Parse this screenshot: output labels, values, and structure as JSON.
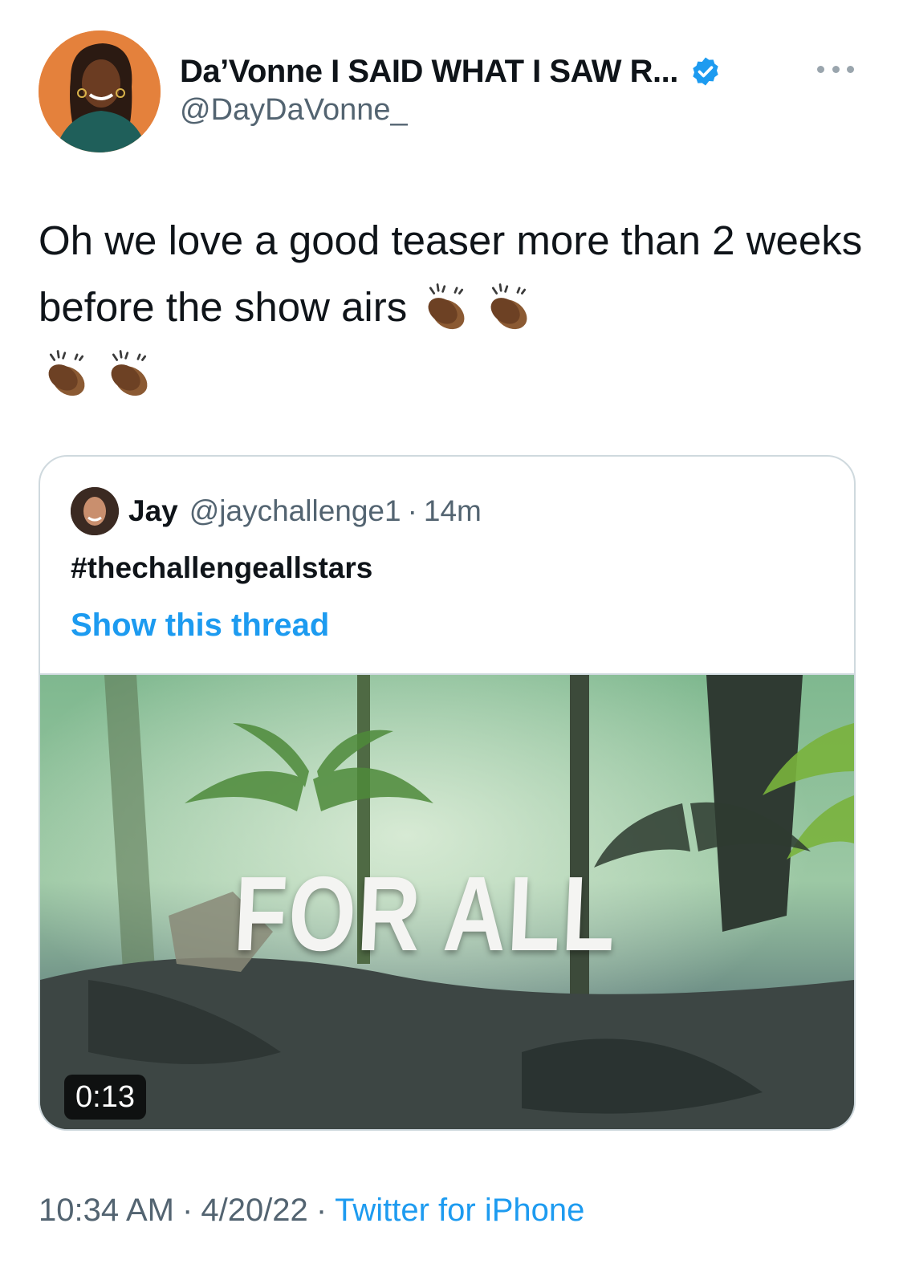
{
  "author": {
    "display_name": "Da’Vonne I SAID WHAT I SAW R...",
    "handle": "@DayDaVonne_",
    "verified_icon": "verified-badge-icon",
    "verified_color": "#1d9bf0"
  },
  "tweet": {
    "text": "Oh we love a good teaser more than 2 weeks before the show airs",
    "emoji": [
      "clapping-hands-icon",
      "clapping-hands-icon",
      "clapping-hands-icon",
      "clapping-hands-icon"
    ]
  },
  "quoted_tweet": {
    "name": "Jay",
    "handle": "@jaychallenge1",
    "separator": "·",
    "time": "14m",
    "text": "#thechallengeallstars",
    "show_thread": "Show this thread",
    "media": {
      "overlay_text": "FOR ALL",
      "duration": "0:13"
    }
  },
  "meta": {
    "time": "10:34 AM",
    "separator": "·",
    "date": "4/20/22",
    "source": "Twitter for iPhone"
  },
  "colors": {
    "link": "#1d9bf0",
    "secondary_text": "#536471",
    "border": "#cfd9de"
  }
}
